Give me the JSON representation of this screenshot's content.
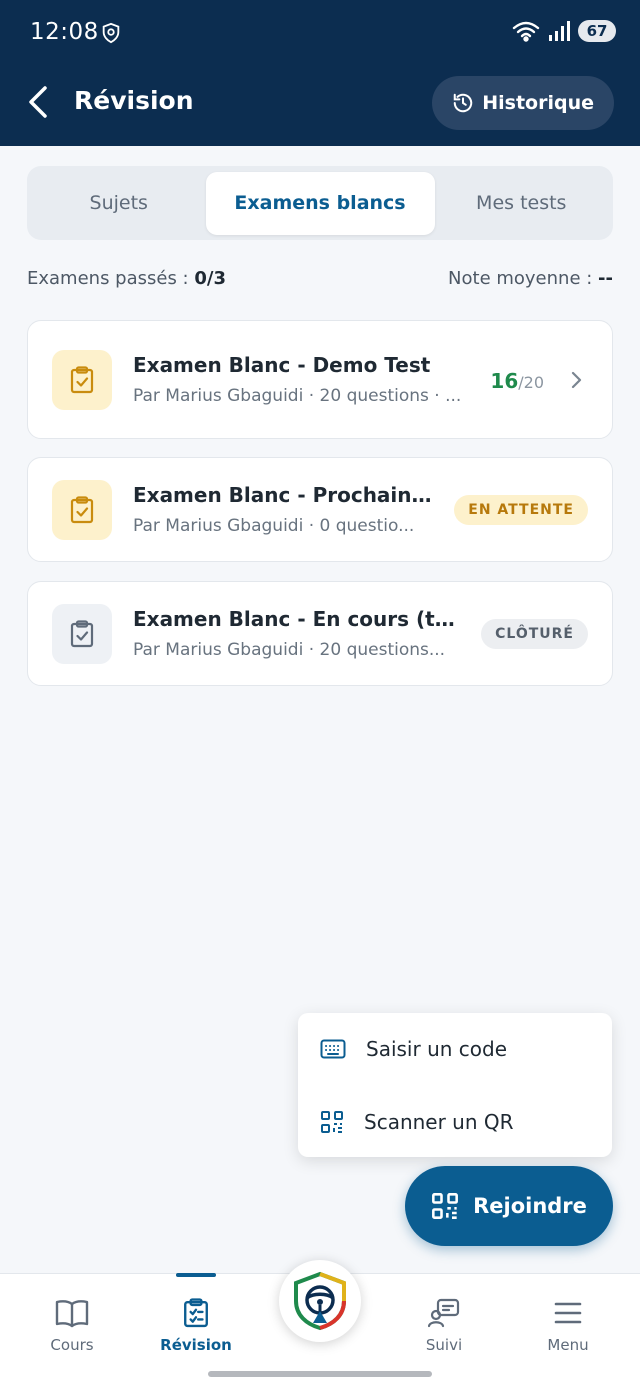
{
  "status": {
    "time": "12:08",
    "battery": "67"
  },
  "header": {
    "title": "Révision",
    "history_label": "Historique"
  },
  "tabs": [
    {
      "label": "Sujets"
    },
    {
      "label": "Examens blancs"
    },
    {
      "label": "Mes tests"
    }
  ],
  "stats": {
    "passed_label": "Examens passés : ",
    "passed_value": "0/3",
    "average_label": "Note moyenne : ",
    "average_value": "--"
  },
  "exams": [
    {
      "title": "Examen Blanc - Demo Test",
      "subtitle": "Par Marius Gbaguidi · 20 questions · ...",
      "score": "16",
      "score_max": "/20"
    },
    {
      "title": "Examen Blanc - Prochain ...",
      "subtitle": "Par Marius Gbaguidi · 0 questio...",
      "badge": "EN ATTENTE"
    },
    {
      "title": "Examen Blanc - En cours (te...",
      "subtitle": "Par Marius Gbaguidi · 20 questions...",
      "badge": "CLÔTURÉ"
    }
  ],
  "join_menu": {
    "enter_code": "Saisir un code",
    "scan_qr": "Scanner un QR"
  },
  "fab": {
    "label": "Rejoindre"
  },
  "nav": [
    {
      "label": "Cours"
    },
    {
      "label": "Révision"
    },
    {
      "label": "Suivi"
    },
    {
      "label": "Menu"
    }
  ],
  "colors": {
    "primary": "#0b5d91",
    "header": "#0c2d50",
    "success": "#1f8a4c",
    "warning": "#b7790c"
  }
}
